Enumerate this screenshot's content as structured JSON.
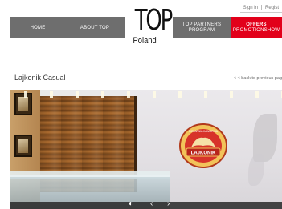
{
  "topbar": {
    "sign_in": "Sign in",
    "register": "Regist"
  },
  "nav": {
    "home": "HOME",
    "about": "ABOUT TOP",
    "partners_line1": "TOP PARTNERS",
    "partners_line2": "PROGRAM",
    "offers_line1": "OFFERS",
    "offers_line2": "PROMOTIONSHOW"
  },
  "logo": {
    "top": "TOP",
    "country": "Poland"
  },
  "page": {
    "title": "Lajkonik Casual",
    "back_link": "< < back to previous pag"
  },
  "sign": {
    "top_text": "PIEKARNIA-KAWIARNIA",
    "brand": "LAJKONIK"
  },
  "colors": {
    "nav_gray": "#6e6e6e",
    "offers_red": "#e2001a"
  }
}
